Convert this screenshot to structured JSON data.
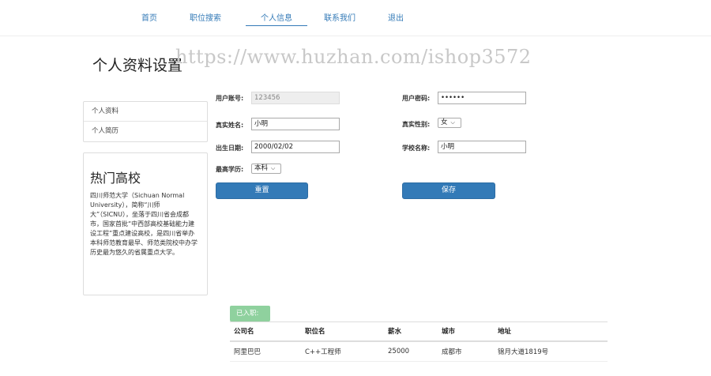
{
  "nav": {
    "items": [
      {
        "label": "首页"
      },
      {
        "label": "职位搜索"
      },
      {
        "label": "个人信息"
      },
      {
        "label": "联系我们"
      },
      {
        "label": "退出"
      }
    ],
    "active_index": 2
  },
  "watermark": "https://www.huzhan.com/ishop3572",
  "page_title": "个人资料设置",
  "side_menu": {
    "items": [
      {
        "label": "个人资料"
      },
      {
        "label": "个人简历"
      }
    ]
  },
  "hot": {
    "title": "热门高校",
    "text": "四川师范大学（Sichuan Normal University），简称“川师大”（SICNU），坐落于四川省会成都市，国家首批“中西部高校基础能力建设工程”重点建设高校，是四川省举办本科师范教育最早、师范类院校中办学历史最为悠久的省属重点大学。"
  },
  "form": {
    "account_label": "用户账号:",
    "account_value": "123456",
    "password_label": "用户密码:",
    "password_value": "••••••",
    "name_label": "真实姓名:",
    "name_value": "小明",
    "gender_label": "真实性别:",
    "gender_value": "女",
    "birth_label": "出生日期:",
    "birth_value": "2000/02/02",
    "school_label": "学校名称:",
    "school_value": "小明",
    "edu_label": "最高学历:",
    "edu_value": "本科",
    "reset_label": "重置",
    "save_label": "保存"
  },
  "employed_badge": "已入职:",
  "jobs": {
    "headers": [
      "公司名",
      "职位名",
      "薪水",
      "城市",
      "地址"
    ],
    "rows": [
      [
        "阿里巴巴",
        "C++工程师",
        "25000",
        "成都市",
        "锦月大道1819号"
      ]
    ]
  },
  "colors": {
    "accent": "#337ab7",
    "badge": "#8fd19e"
  }
}
